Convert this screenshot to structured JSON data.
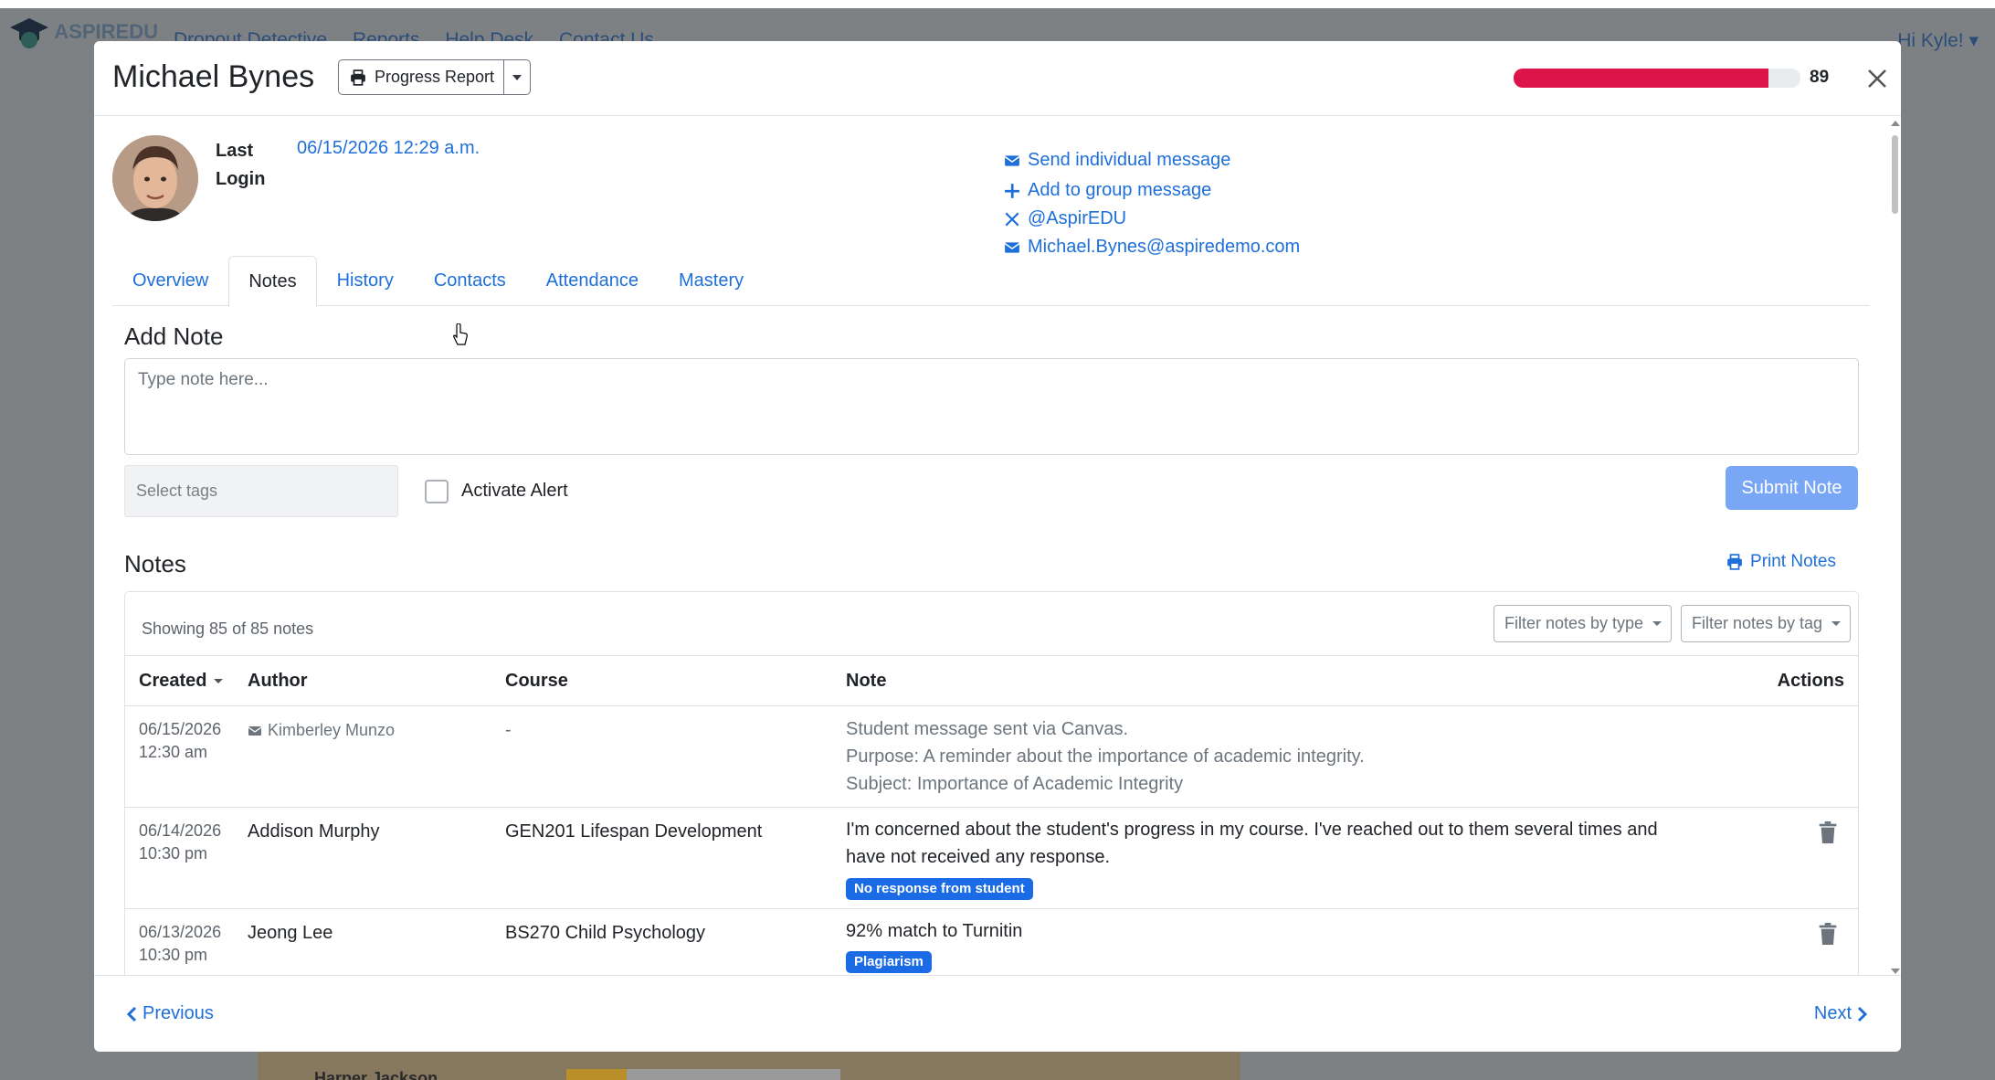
{
  "background": {
    "brand": "ASPIREDU",
    "nav_links": [
      "Dropout Detective",
      "Reports",
      "Help Desk",
      "Contact Us"
    ],
    "greeting": "Hi Kyle!",
    "row_name": "Harper Jackson"
  },
  "header": {
    "student_name": "Michael Bynes",
    "progress_report_label": "Progress Report",
    "risk_value": "89",
    "risk_fraction": 0.89,
    "risk_color": "#dc1449"
  },
  "profile": {
    "last_login_label": "Last Login",
    "last_login_value": "06/15/2026 12:29 a.m.",
    "links": {
      "send_message": "Send individual message",
      "group_message": "Add to group message",
      "twitter": "@AspirEDU",
      "email": "Michael.Bynes@aspiredemo.com"
    }
  },
  "tabs": [
    "Overview",
    "Notes",
    "History",
    "Contacts",
    "Attendance",
    "Mastery"
  ],
  "add_note": {
    "title": "Add Note",
    "placeholder": "Type note here...",
    "tags_placeholder": "Select tags",
    "alert_label": "Activate Alert",
    "submit_label": "Submit Note"
  },
  "notes": {
    "title": "Notes",
    "print_label": "Print Notes",
    "showing": "Showing 85 of 85 notes",
    "filter_type": "Filter notes by type",
    "filter_tag": "Filter notes by tag",
    "columns": {
      "created": "Created",
      "author": "Author",
      "course": "Course",
      "note": "Note",
      "actions": "Actions"
    },
    "rows": [
      {
        "date": "06/15/2026",
        "time": "12:30 am",
        "author": "Kimberley Munzo",
        "course": "-",
        "lines": [
          "Student message sent via Canvas.",
          "Purpose: A reminder about the importance of academic integrity.",
          "Subject: Importance of Academic Integrity"
        ]
      },
      {
        "date": "06/14/2026",
        "time": "10:30 pm",
        "author": "Addison Murphy",
        "course": "GEN201 Lifespan Development",
        "lines": [
          "I'm concerned about the student's progress in my course. I've reached out to them several times and",
          "have not received any response."
        ],
        "tag": "No response from student"
      },
      {
        "date": "06/13/2026",
        "time": "10:30 pm",
        "author": "Jeong Lee",
        "course": "BS270 Child Psychology",
        "lines": [
          "92% match to Turnitin"
        ],
        "tag": "Plagiarism"
      }
    ]
  },
  "footer": {
    "previous": "Previous",
    "next": "Next"
  }
}
